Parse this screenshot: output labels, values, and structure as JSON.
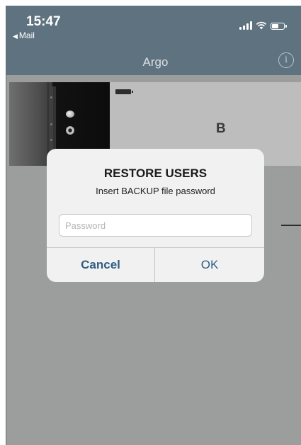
{
  "status_bar": {
    "time": "15:47",
    "back_app": "Mail"
  },
  "nav": {
    "title": "Argo",
    "info_icon": "info-icon"
  },
  "device_card": {
    "name": "B",
    "battery_icon": "battery-icon",
    "image_icon": "door-lock-image"
  },
  "dialog": {
    "title": "RESTORE USERS",
    "message": "Insert BACKUP file password",
    "password_placeholder": "Password",
    "password_value": "",
    "cancel_label": "Cancel",
    "ok_label": "OK"
  },
  "colors": {
    "nav_bar": "#5f7280",
    "dim_overlay": "#9c9d9d",
    "dialog_bg": "#f1f1f1",
    "button_text": "#2f5d82"
  }
}
